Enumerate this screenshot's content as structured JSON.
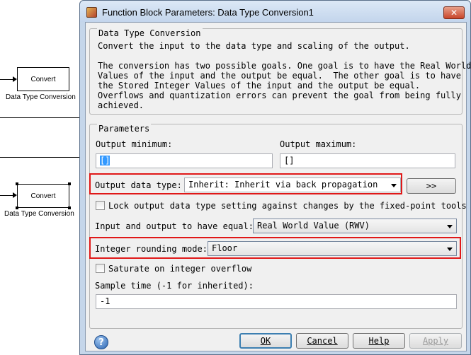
{
  "canvas": {
    "block1": {
      "label": "Convert",
      "caption": "Data Type Conversion"
    },
    "block2": {
      "label": "Convert",
      "caption": "Data Type Conversion"
    }
  },
  "window": {
    "title": "Function Block Parameters: Data Type Conversion1",
    "close_glyph": "✕"
  },
  "description": {
    "group_title": "Data Type Conversion",
    "line1": "Convert the input to the data type and scaling of the output.",
    "para": [
      "The conversion has two possible goals. One goal is to have the Real World",
      "Values of the input and the output be equal.  The other goal is to have",
      "the Stored Integer Values of the input and the output be equal.",
      "Overflows and quantization errors can prevent the goal from being fully",
      "achieved."
    ]
  },
  "parameters": {
    "group_title": "Parameters",
    "output_min_label": "Output minimum:",
    "output_min_value": "[]",
    "output_max_label": "Output maximum:",
    "output_max_value": "[]",
    "output_data_type_label": "Output data type:",
    "output_data_type_value": "Inherit: Inherit via back propagation",
    "data_type_assistant_label": ">>",
    "lock_label": "Lock output data type setting against changes by the fixed-point tools",
    "equal_label": "Input and output to have equal:",
    "equal_value": "Real World Value (RWV)",
    "rounding_label": "Integer rounding mode:",
    "rounding_value": "Floor",
    "saturate_label": "Saturate on integer overflow",
    "sample_time_label": "Sample time (-1 for inherited):",
    "sample_time_value": "-1"
  },
  "buttons": {
    "ok": "OK",
    "cancel": "Cancel",
    "help": "Help",
    "apply": "Apply"
  },
  "colors": {
    "highlight": "#e01818",
    "selection": "#3399ff"
  }
}
